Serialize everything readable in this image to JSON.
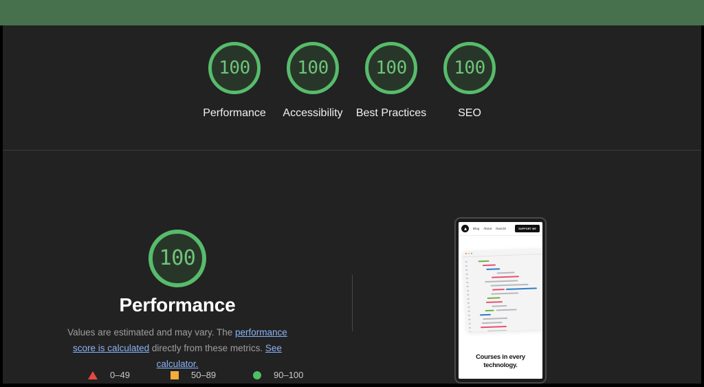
{
  "theme": {
    "top_band_color": "#47714c",
    "report_bg": "#222222",
    "gauge_ring_green": "#57bc6b",
    "gauge_fill_green": "#28362a",
    "link_blue": "#8ab4f8",
    "marker_red": "#e8483f",
    "marker_orange": "#f5ab3c",
    "marker_green": "#4dc163"
  },
  "gauges": [
    {
      "score": "100",
      "label": "Performance"
    },
    {
      "score": "100",
      "label": "Accessibility"
    },
    {
      "score": "100",
      "label": "Best Practices"
    },
    {
      "score": "100",
      "label": "SEO"
    }
  ],
  "detail": {
    "score": "100",
    "title": "Performance",
    "description_prefix": "Values are estimated and may vary. The ",
    "link_score_calculated": "performance score is calculated",
    "description_middle": " directly from these metrics. ",
    "link_see_calculator": "See calculator."
  },
  "legend": [
    {
      "marker": "triangle-icon",
      "range": "0–49"
    },
    {
      "marker": "square-icon",
      "range": "50–89"
    },
    {
      "marker": "circle-icon",
      "range": "90–100"
    }
  ],
  "preview": {
    "nav": {
      "logo": "site-logo-icon",
      "links": [
        "Blog",
        "About",
        "NuxtJS"
      ],
      "cta": "SUPPORT ME"
    },
    "caption": "Courses in every technology.",
    "chart": {
      "type": "bar",
      "rows": [
        {
          "segments": [
            {
              "offset": 14,
              "width": 16,
              "color": "#6db33f"
            }
          ]
        },
        {
          "segments": [
            {
              "offset": 20,
              "width": 19,
              "color": "#e8506e"
            }
          ]
        },
        {
          "segments": [
            {
              "offset": 25,
              "width": 20,
              "color": "#2b7cc4"
            }
          ]
        },
        {
          "segments": [
            {
              "offset": 40,
              "width": 26,
              "color": "#b8b8bc"
            }
          ]
        },
        {
          "segments": [
            {
              "offset": 32,
              "width": 40,
              "color": "#e8506e"
            }
          ]
        },
        {
          "segments": [
            {
              "offset": 22,
              "width": 48,
              "color": "#b8b8bc"
            }
          ]
        },
        {
          "segments": [
            {
              "offset": 30,
              "width": 55,
              "color": "#b8b8bc"
            }
          ]
        },
        {
          "segments": [
            {
              "offset": 32,
              "width": 18,
              "color": "#e8506e"
            },
            {
              "offset": 2,
              "width": 45,
              "color": "#2b7cc4"
            }
          ]
        },
        {
          "segments": [
            {
              "offset": 30,
              "width": 40,
              "color": "#b8b8bc"
            }
          ]
        },
        {
          "segments": [
            {
              "offset": 24,
              "width": 19,
              "color": "#6db33f"
            }
          ]
        },
        {
          "segments": [
            {
              "offset": 22,
              "width": 24,
              "color": "#e8506e"
            }
          ]
        },
        {
          "segments": [
            {
              "offset": 30,
              "width": 22,
              "color": "#b8b8bc"
            }
          ]
        },
        {
          "segments": [
            {
              "offset": 20,
              "width": 13,
              "color": "#6db33f"
            },
            {
              "offset": 3,
              "width": 30,
              "color": "#b8b8bc"
            }
          ]
        },
        {
          "segments": [
            {
              "offset": 12,
              "width": 16,
              "color": "#2b7cc4"
            }
          ]
        },
        {
          "segments": [
            {
              "offset": 16,
              "width": 36,
              "color": "#b8b8bc"
            }
          ]
        },
        {
          "segments": [
            {
              "offset": 14,
              "width": 30,
              "color": "#b8b8bc"
            }
          ]
        },
        {
          "segments": [
            {
              "offset": 12,
              "width": 38,
              "color": "#e8506e"
            }
          ]
        },
        {
          "segments": [
            {
              "offset": 22,
              "width": 28,
              "color": "#b8b8bc"
            }
          ]
        },
        {
          "segments": [
            {
              "offset": 14,
              "width": 62,
              "color": "#6db33f"
            }
          ]
        },
        {
          "segments": [
            {
              "offset": 16,
              "width": 20,
              "color": "#b8b8bc"
            }
          ]
        }
      ]
    }
  }
}
